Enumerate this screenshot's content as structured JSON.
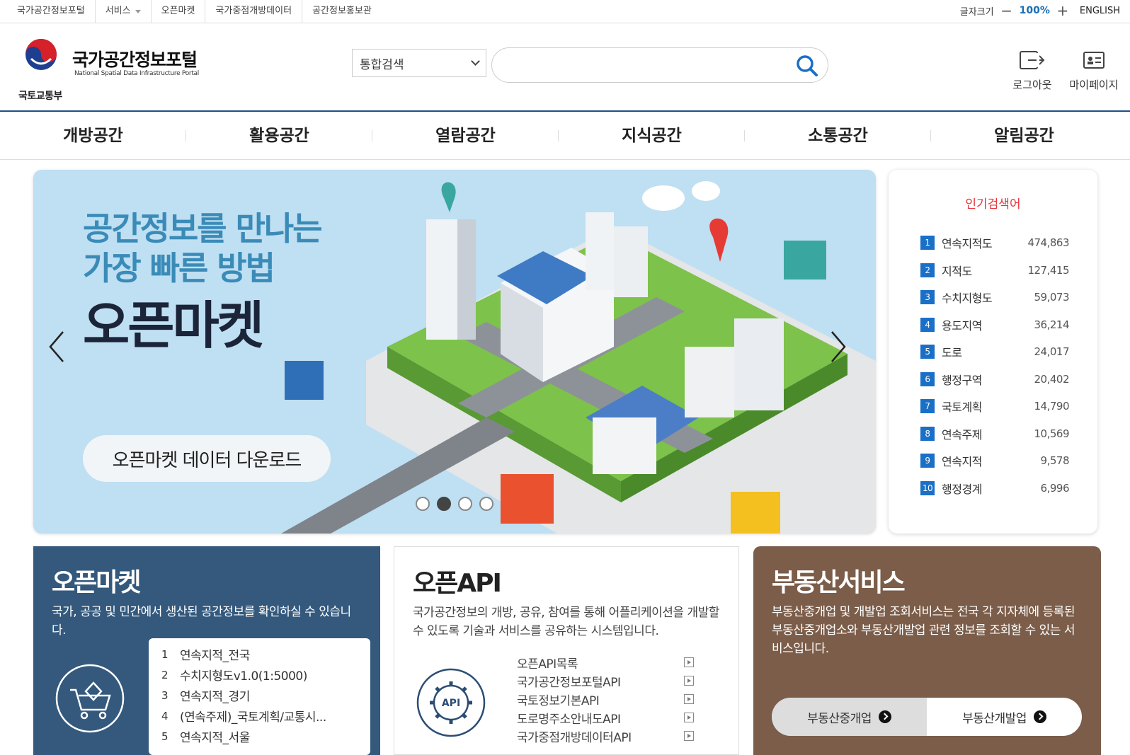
{
  "utility": {
    "links": [
      "국가공간정보포털",
      "서비스",
      "오픈마켓",
      "국가중점개방데이터",
      "공간정보홍보관"
    ],
    "font_size_label": "글자크기",
    "font_size_value": "100%",
    "english": "ENGLISH"
  },
  "header": {
    "ministry": "국토교통부",
    "title": "국가공간정보포털",
    "subtitle": "National Spatial Data Infrastructure Portal",
    "search_scope": "통합검색",
    "search_placeholder": "",
    "logout": "로그아웃",
    "mypage": "마이페이지"
  },
  "gnb": [
    "개방공간",
    "활용공간",
    "열람공간",
    "지식공간",
    "소통공간",
    "알림공간"
  ],
  "banner": {
    "headline_line1": "공간정보를 만나는",
    "headline_line2": "가장 빠른 방법",
    "headline_main": "오픈마켓",
    "cta": "오픈마켓 데이터 다운로드",
    "slides": 4,
    "active_slide": 2
  },
  "popular": {
    "title": "인기검색어",
    "items": [
      {
        "rank": "1",
        "name": "연속지적도",
        "count": "474,863"
      },
      {
        "rank": "2",
        "name": "지적도",
        "count": "127,415"
      },
      {
        "rank": "3",
        "name": "수치지형도",
        "count": "59,073"
      },
      {
        "rank": "4",
        "name": "용도지역",
        "count": "36,214"
      },
      {
        "rank": "5",
        "name": "도로",
        "count": "24,017"
      },
      {
        "rank": "6",
        "name": "행정구역",
        "count": "20,402"
      },
      {
        "rank": "7",
        "name": "국토계획",
        "count": "14,790"
      },
      {
        "rank": "8",
        "name": "연속주제",
        "count": "10,569"
      },
      {
        "rank": "9",
        "name": "연속지적",
        "count": "9,578"
      },
      {
        "rank": "10",
        "name": "행정경계",
        "count": "6,996"
      }
    ]
  },
  "open_market": {
    "title": "오픈마켓",
    "desc": "국가, 공공 및 민간에서 생산된 공간정보를 확인하실 수 있습니다.",
    "items": [
      {
        "n": "1",
        "label": "연속지적_전국"
      },
      {
        "n": "2",
        "label": "수치지형도v1.0(1:5000)"
      },
      {
        "n": "3",
        "label": "연속지적_경기"
      },
      {
        "n": "4",
        "label": "(연속주제)_국토계획/교통시..."
      },
      {
        "n": "5",
        "label": "연속지적_서울"
      }
    ]
  },
  "open_api": {
    "title": "오픈API",
    "desc": "국가공간정보의 개방, 공유, 참여를 통해 어플리케이션을 개발할 수 있도록 기술과 서비스를 공유하는 시스템입니다.",
    "icon_label": "API",
    "items": [
      "오픈API목록",
      "국가공간정보포털API",
      "국토정보기본API",
      "도로명주소안내도API",
      "국가중점개방데이터API"
    ]
  },
  "realestate": {
    "title": "부동산서비스",
    "desc": "부동산중개업 및 개발업 조회서비스는 전국 각 지자체에 등록된 부동산중개업소와 부동산개발업 관련 정보를 조회할 수 있는 서비스입니다.",
    "tab1": "부동산중개업",
    "tab2": "부동산개발업"
  },
  "colors": {
    "brand_blue": "#1e4f8a",
    "keyword_red": "#e8323a",
    "rank_blue": "#1a6fc7",
    "market_card": "#34597d",
    "realestate_card": "#7b5d49"
  }
}
